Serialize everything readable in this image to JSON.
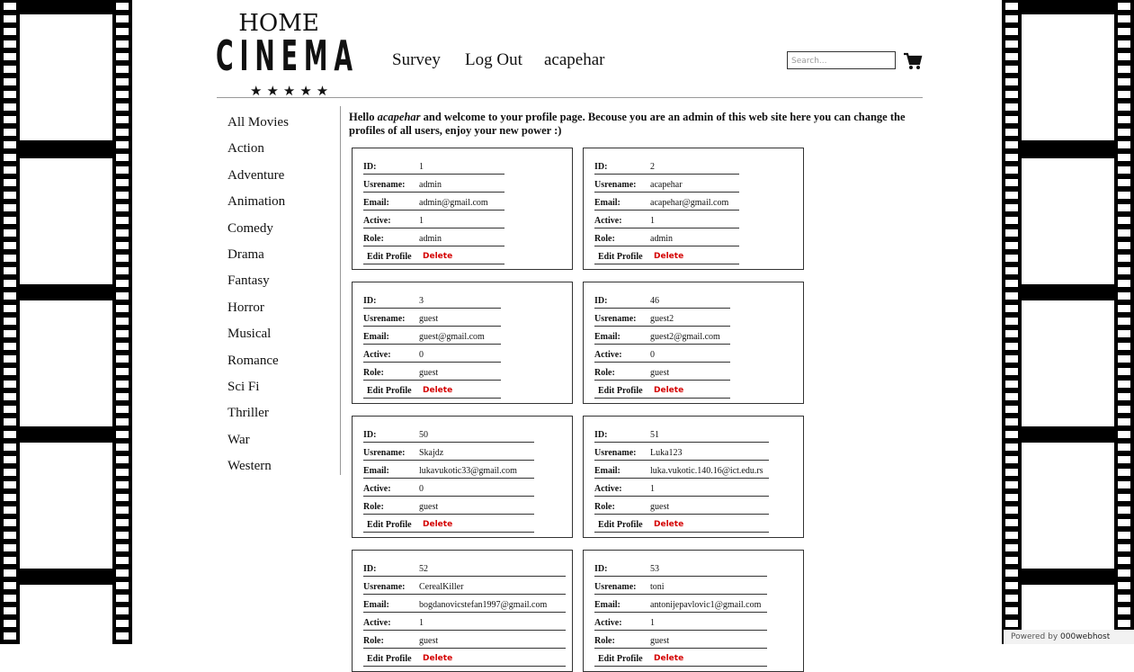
{
  "logo": {
    "home": "HOME",
    "cinema": "CINEMA",
    "stars": "★★★★★"
  },
  "nav": {
    "survey": "Survey",
    "logout": "Log Out",
    "user": "acapehar"
  },
  "search": {
    "placeholder": "Search..."
  },
  "icons": {
    "cart": "cart-icon"
  },
  "sidebar": {
    "items": [
      "All Movies",
      "Action",
      "Adventure",
      "Animation",
      "Comedy",
      "Drama",
      "Fantasy",
      "Horror",
      "Musical",
      "Romance",
      "Sci Fi",
      "Thriller",
      "War",
      "Western"
    ]
  },
  "welcome": {
    "hello": "Hello ",
    "user": "acapehar",
    "rest": " and welcome to your profile page. Becouse you are an admin of this web site here you can change the profiles of all users, enjoy your new power :)"
  },
  "labels": {
    "id": "ID:",
    "username": "Usrename:",
    "email": "Email:",
    "active": "Active:",
    "role": "Role:",
    "edit": "Edit Profile",
    "delete": "Delete"
  },
  "users": [
    {
      "id": "1",
      "username": "admin",
      "email": "admin@gmail.com",
      "active": "1",
      "role": "admin"
    },
    {
      "id": "2",
      "username": "acapehar",
      "email": "acapehar@gmail.com",
      "active": "1",
      "role": "admin"
    },
    {
      "id": "3",
      "username": "guest",
      "email": "guest@gmail.com",
      "active": "0",
      "role": "guest"
    },
    {
      "id": "46",
      "username": "guest2",
      "email": "guest2@gmail.com",
      "active": "0",
      "role": "guest"
    },
    {
      "id": "50",
      "username": "Skajdz",
      "email": "lukavukotic33@gmail.com",
      "active": "0",
      "role": "guest"
    },
    {
      "id": "51",
      "username": "Luka123",
      "email": "luka.vukotic.140.16@ict.edu.rs",
      "active": "1",
      "role": "guest"
    },
    {
      "id": "52",
      "username": "CerealKiller",
      "email": "bogdanovicstefan1997@gmail.com",
      "active": "1",
      "role": "guest"
    },
    {
      "id": "53",
      "username": "toni",
      "email": "antonijepavlovic1@gmail.com",
      "active": "1",
      "role": "guest"
    }
  ],
  "badge": {
    "prefix": "Powered by",
    "brand": "000webhost"
  }
}
